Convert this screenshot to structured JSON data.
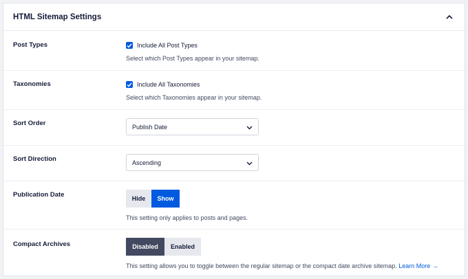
{
  "header": {
    "title": "HTML Sitemap Settings",
    "collapse_icon": "chevron-up-icon"
  },
  "post_types": {
    "label": "Post Types",
    "checkbox_label": "Include All Post Types",
    "checked": true,
    "description": "Select which Post Types appear in your sitemap."
  },
  "taxonomies": {
    "label": "Taxonomies",
    "checkbox_label": "Include All Taxonomies",
    "checked": true,
    "description": "Select which Taxonomies appear in your sitemap."
  },
  "sort_order": {
    "label": "Sort Order",
    "value": "Publish Date"
  },
  "sort_direction": {
    "label": "Sort Direction",
    "value": "Ascending"
  },
  "publication_date": {
    "label": "Publication Date",
    "options": [
      "Hide",
      "Show"
    ],
    "selected": "Show",
    "description": "This setting only applies to posts and pages."
  },
  "compact_archives": {
    "label": "Compact Archives",
    "options": [
      "Disabled",
      "Enabled"
    ],
    "selected": "Disabled",
    "description": "This setting allows you to toggle between the regular sitemap or the compact date archive sitemap.",
    "learn_more": "Learn More →"
  },
  "colors": {
    "accent": "#005ae0",
    "dark_toggle": "#434960",
    "text": "#141b38",
    "muted_text": "#434960"
  }
}
